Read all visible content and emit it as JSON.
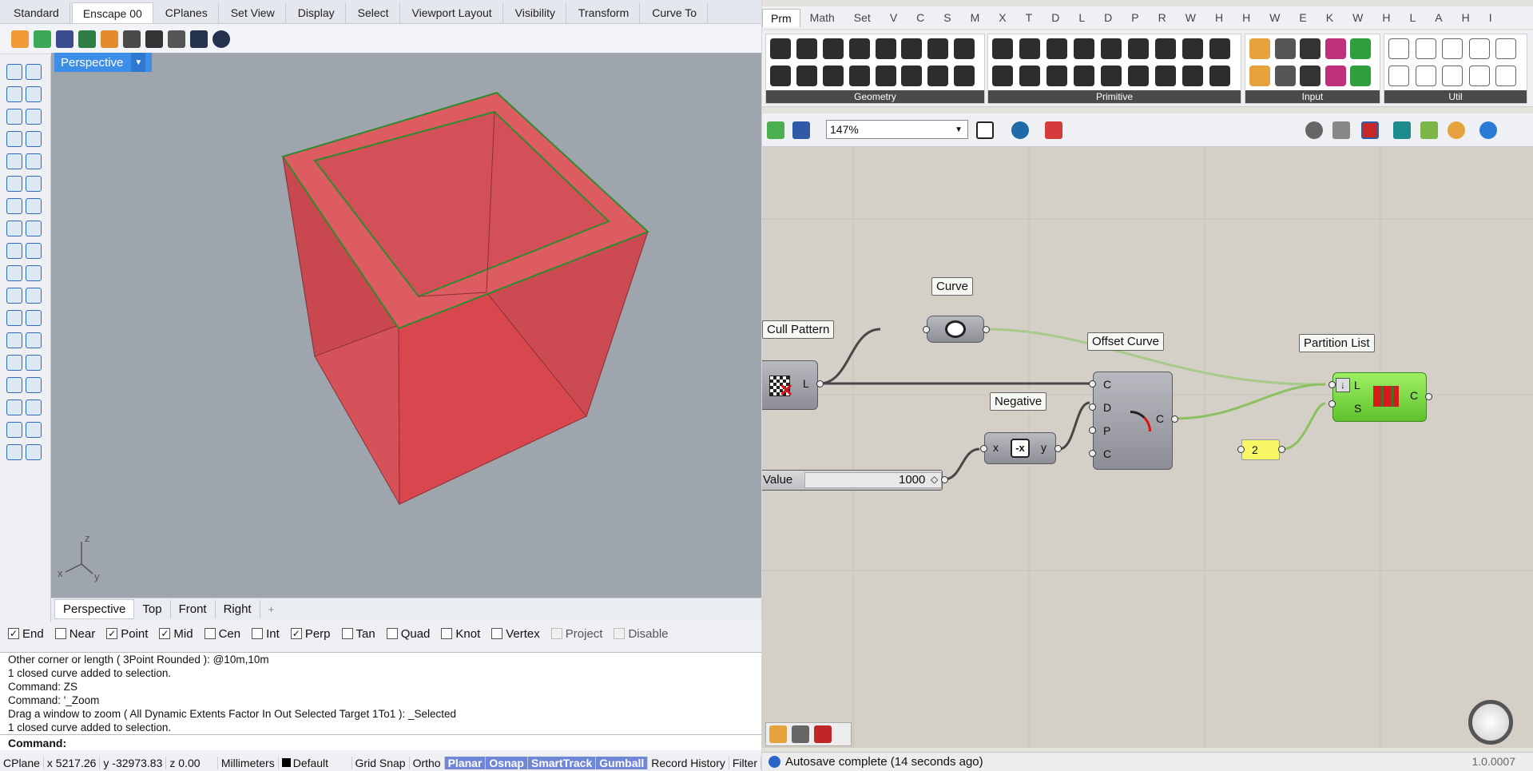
{
  "rhino": {
    "tabs": [
      "Standard",
      "Enscape 00",
      "CPlanes",
      "Set View",
      "Display",
      "Select",
      "Viewport Layout",
      "Visibility",
      "Transform",
      "Curve To"
    ],
    "active_tab": "Enscape 00",
    "viewport": {
      "label": "Perspective",
      "axes": {
        "z": "z",
        "x": "x",
        "y": "y"
      }
    },
    "viewport_tabs": [
      "Perspective",
      "Top",
      "Front",
      "Right"
    ],
    "snaps": [
      {
        "label": "End",
        "checked": true,
        "enabled": true
      },
      {
        "label": "Near",
        "checked": false,
        "enabled": true
      },
      {
        "label": "Point",
        "checked": true,
        "enabled": true
      },
      {
        "label": "Mid",
        "checked": true,
        "enabled": true
      },
      {
        "label": "Cen",
        "checked": false,
        "enabled": true
      },
      {
        "label": "Int",
        "checked": false,
        "enabled": true
      },
      {
        "label": "Perp",
        "checked": true,
        "enabled": true
      },
      {
        "label": "Tan",
        "checked": false,
        "enabled": true
      },
      {
        "label": "Quad",
        "checked": false,
        "enabled": true
      },
      {
        "label": "Knot",
        "checked": false,
        "enabled": true
      },
      {
        "label": "Vertex",
        "checked": false,
        "enabled": true
      },
      {
        "label": "Project",
        "checked": false,
        "enabled": false
      },
      {
        "label": "Disable",
        "checked": false,
        "enabled": false
      }
    ],
    "command_history": [
      "Other corner or length ( 3Point  Rounded ): @10m,10m",
      "1 closed curve added to selection.",
      "Command: ZS",
      "Command: '_Zoom",
      "Drag a window to zoom ( All  Dynamic  Extents  Factor  In  Out  Selected  Target  1To1 ): _Selected",
      "1 closed curve added to selection."
    ],
    "command_prompt": "Command:",
    "status": {
      "cplane": "CPlane",
      "x": "x 5217.26",
      "y": "y -32973.83",
      "z": "z 0.00",
      "units": "Millimeters",
      "layer": "Default",
      "buttons": [
        {
          "label": "Grid Snap",
          "on": false
        },
        {
          "label": "Ortho",
          "on": false
        },
        {
          "label": "Planar",
          "on": true
        },
        {
          "label": "Osnap",
          "on": true
        },
        {
          "label": "SmartTrack",
          "on": true
        },
        {
          "label": "Gumball",
          "on": true
        },
        {
          "label": "Record History",
          "on": false
        },
        {
          "label": "Filter",
          "on": false
        }
      ]
    }
  },
  "grasshopper": {
    "tabs": [
      "Prm",
      "Math",
      "Set",
      "V",
      "C",
      "S",
      "M",
      "X",
      "T",
      "D",
      "L",
      "D",
      "P",
      "R",
      "W",
      "H",
      "H",
      "W",
      "E",
      "K",
      "W",
      "H",
      "L",
      "A",
      "H",
      "I"
    ],
    "active_tab": "Prm",
    "panels": [
      "Geometry",
      "Primitive",
      "Input",
      "Util"
    ],
    "zoom": "147%",
    "nodes": {
      "cull_pattern": {
        "label": "Cull Pattern",
        "output": "L"
      },
      "curve": {
        "label": "Curve"
      },
      "offset_curve": {
        "label": "Offset Curve",
        "inputs": [
          "C",
          "D",
          "P",
          "C"
        ],
        "output": "C"
      },
      "negative": {
        "label": "Negative",
        "input": "x",
        "output": "y"
      },
      "value_slider": {
        "label": "Value",
        "value": "1000"
      },
      "partition_list": {
        "label": "Partition List",
        "inputs": [
          "L",
          "S"
        ],
        "output": "C"
      },
      "panel_two": {
        "value": "2"
      }
    },
    "status_message": "Autosave complete (14 seconds ago)",
    "version": "1.0.0007"
  }
}
